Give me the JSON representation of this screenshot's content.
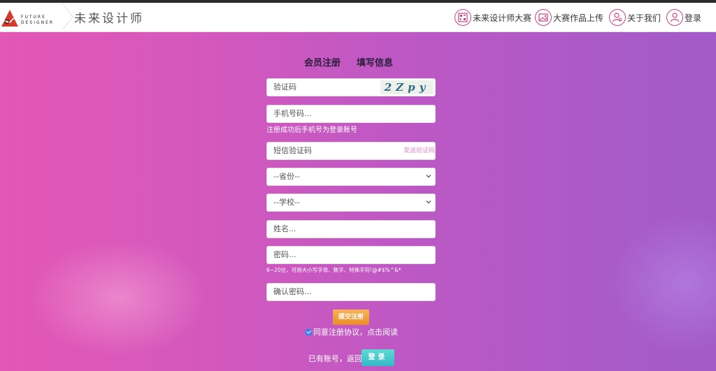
{
  "header": {
    "logo_text_line1": "FUTURE",
    "logo_text_line2": "DESIGNER",
    "site_title": "未来设计师",
    "nav": [
      {
        "label": "未来设计师大赛",
        "icon": "qr-code-icon"
      },
      {
        "label": "大赛作品上传",
        "icon": "image-upload-icon"
      },
      {
        "label": "关于我们",
        "icon": "team-icon"
      },
      {
        "label": "登录",
        "icon": "user-icon"
      }
    ]
  },
  "form": {
    "title_member": "会员注册",
    "title_step": "填写信息",
    "captcha_placeholder": "验证码",
    "captcha_text": "2Zpy",
    "phone_placeholder": "手机号码...",
    "phone_hint": "注册成功后手机号为登录账号",
    "sms_placeholder": "短信验证码",
    "sms_send_label": "发送验证码",
    "province_selected": "--省份--",
    "school_selected": "--学校--",
    "name_placeholder": "姓名...",
    "password_placeholder": "密码...",
    "password_hint": "6~20位，可用大小写字母、数字、特殊字符!@#$%^&*",
    "confirm_placeholder": "确认密码...",
    "submit_label": "提交注册",
    "agree_label": "同意注册协议，点击阅读",
    "agree_checked": true,
    "has_account_text": "已有账号，返回",
    "login_label": "登录"
  },
  "colors": {
    "brand_pink": "#d0417d",
    "submit_orange": "#ea8c25",
    "login_teal": "#33b9c7",
    "sms_link": "#e08bc9"
  }
}
